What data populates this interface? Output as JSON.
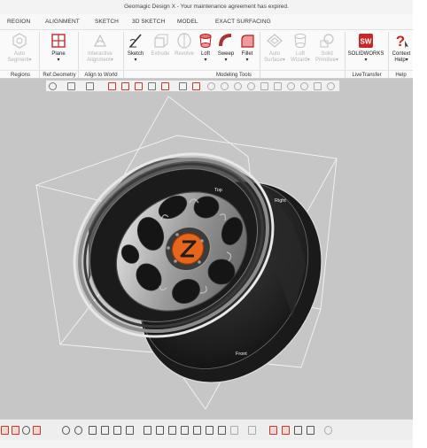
{
  "window": {
    "title": "Geomagic Design X - Your maintenance agreement has expired."
  },
  "ribbon_tabs": [
    "REGION",
    "ALIGNMENT",
    "SKETCH",
    "3D SKETCH",
    "MODEL",
    "EXACT SURFACING"
  ],
  "ribbon": {
    "buttons": {
      "auto_segment": "Auto Segment▾",
      "plane": "Plane",
      "plane_arrow": "▾",
      "interactive_alignment": "Interactive Alignment▾",
      "sketch": "Sketch",
      "sketch_arrow": "▾",
      "extrude": "Extrude",
      "revolve": "Revolve",
      "loft": "Loft",
      "loft_arrow": "▾",
      "sweep": "Sweep",
      "sweep_arrow": "▾",
      "fillet": "Fillet",
      "fillet_arrow": "▾",
      "auto_surface": "Auto Surface▾",
      "loft_wizard": "Loft Wizard▾",
      "solid_primitive": "Solid Primitive▾",
      "solidworks": "SOLIDWORKS",
      "solidworks_arrow": "▾",
      "context_help": "Context Help▾"
    },
    "groups": [
      "Regions",
      "Ref.Geometry",
      "Align to World",
      "Modeling Tools",
      "LiveTransfer",
      "Help"
    ]
  },
  "viewport": {
    "plane_labels": [
      "Top",
      "Right",
      "Front"
    ]
  },
  "colors": {
    "accent_red": "#c62828",
    "hub_orange": "#e8661b",
    "viewport_bg": "#c6c6c6"
  }
}
